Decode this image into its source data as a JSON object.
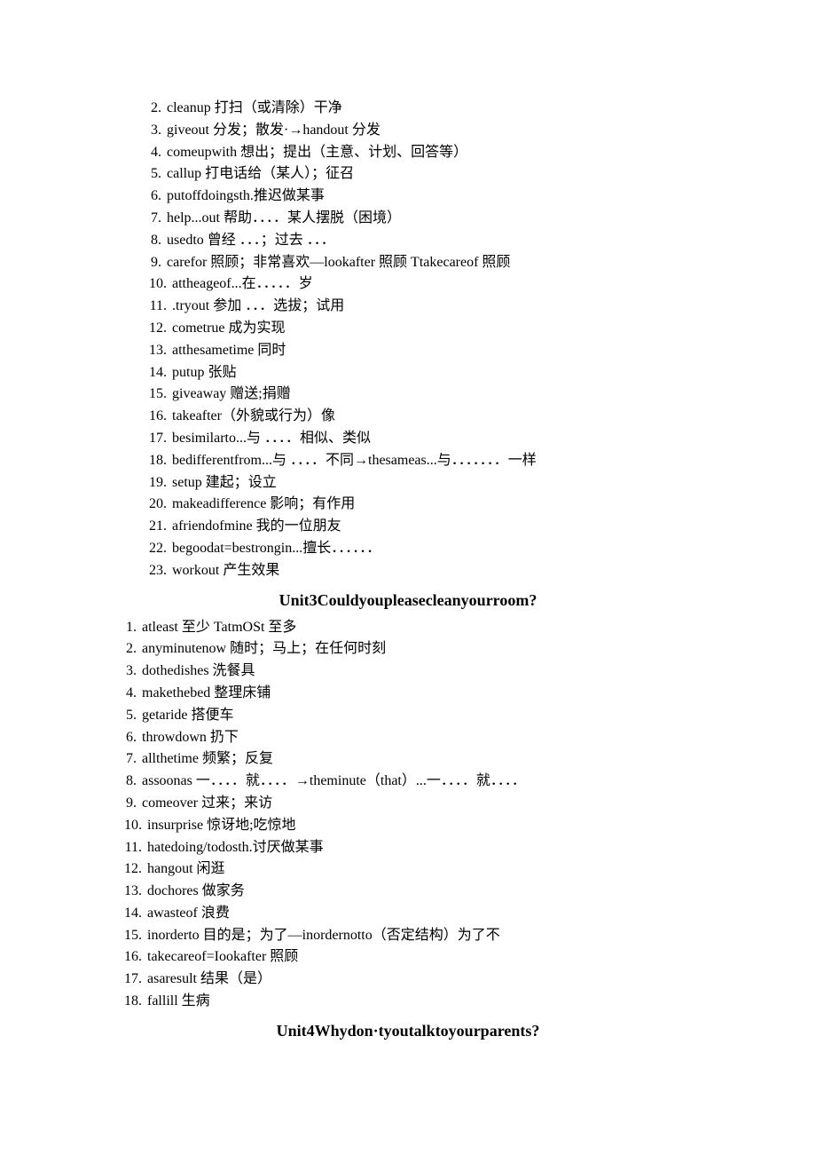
{
  "list1": [
    {
      "n": "2.",
      "t": "cleanup 打扫（或清除）干净"
    },
    {
      "n": "3.",
      "t": "giveout 分发；散发·→handout 分发"
    },
    {
      "n": "4.",
      "t": "comeupwith 想出；提出（主意、计划、回答等）"
    },
    {
      "n": "5.",
      "t": "callup 打电话给（某人）；征召"
    },
    {
      "n": "6.",
      "t": "putoffdoingsth.推迟做某事"
    },
    {
      "n": "7.",
      "t": "help...out 帮助．．．．某人摆脱（困境）"
    },
    {
      "n": "8.",
      "t": "usedto 曾经 ．．．；过去 ．．．"
    },
    {
      "n": "9.",
      "t": "carefor 照顾；非常喜欢—lookafter 照顾 Ttakecareof 照顾"
    },
    {
      "n": "10.",
      "t": " attheageof...在．．．．．岁"
    },
    {
      "n": "11.",
      "t": ".tryout 参加 ．．．选拔；试用"
    },
    {
      "n": "12.",
      "t": " cometrue 成为实现"
    },
    {
      "n": "13.",
      "t": " atthesametime 同时"
    },
    {
      "n": "14.",
      "t": " putup 张贴"
    },
    {
      "n": "15.",
      "t": " giveaway 赠送;捐赠"
    },
    {
      "n": "16.",
      "t": " takeafter（外貌或行为）像"
    },
    {
      "n": "17.",
      "t": " besimilarto...与 ．．．．相似、类似"
    },
    {
      "n": "18.",
      "t": " bedifferentfrom...与 ．．．．不同→thesameas...与．．．．．．．一样"
    },
    {
      "n": "19.",
      "t": " setup 建起；设立"
    },
    {
      "n": "20.",
      "t": " makeadifference 影响；有作用"
    },
    {
      "n": "21.",
      "t": " afriendofmine 我的一位朋友"
    },
    {
      "n": "22.",
      "t": " begoodat=bestrongin...擅长．．．．．．"
    },
    {
      "n": "23.",
      "t": " workout 产生效果"
    }
  ],
  "heading1": "Unit3Couldyoupleasecleanyourroom?",
  "list2": [
    {
      "n": "1.",
      "t": "atleast 至少 TatmOSt 至多"
    },
    {
      "n": "2.",
      "t": "anyminutenow 随时；马上；在任何时刻"
    },
    {
      "n": "3.",
      "t": "dothedishes 洗餐具"
    },
    {
      "n": "4.",
      "t": "makethebed 整理床铺"
    },
    {
      "n": "5.",
      "t": "getaride 搭便车"
    },
    {
      "n": "6.",
      "t": "throwdown 扔下"
    },
    {
      "n": "7.",
      "t": "allthetime 频繁；反复"
    },
    {
      "n": "8.",
      "t": "assoonas 一．．．．就．．．．→theminute（that）...一．．．．就．．．．"
    },
    {
      "n": "9.",
      "t": "comeover 过来；来访"
    },
    {
      "n": "10.",
      "t": " insurprise 惊讶地;吃惊地"
    },
    {
      "n": "11.",
      "t": " hatedoing/todosth.讨厌做某事"
    },
    {
      "n": "12.",
      "t": " hangout 闲逛"
    },
    {
      "n": "13.",
      "t": " dochores 做家务"
    },
    {
      "n": "14.",
      "t": " awasteof 浪费"
    },
    {
      "n": "15.",
      "t": " inorderto 目的是；为了—inordernotto（否定结构）为了不"
    },
    {
      "n": "16.",
      "t": " takecareof=Iookafter 照顾"
    },
    {
      "n": "17.",
      "t": " asaresult 结果（是）"
    },
    {
      "n": "18.",
      "t": " fallill 生病"
    }
  ],
  "heading2": "Unit4Whydon·tyoutalktoyourparents?"
}
